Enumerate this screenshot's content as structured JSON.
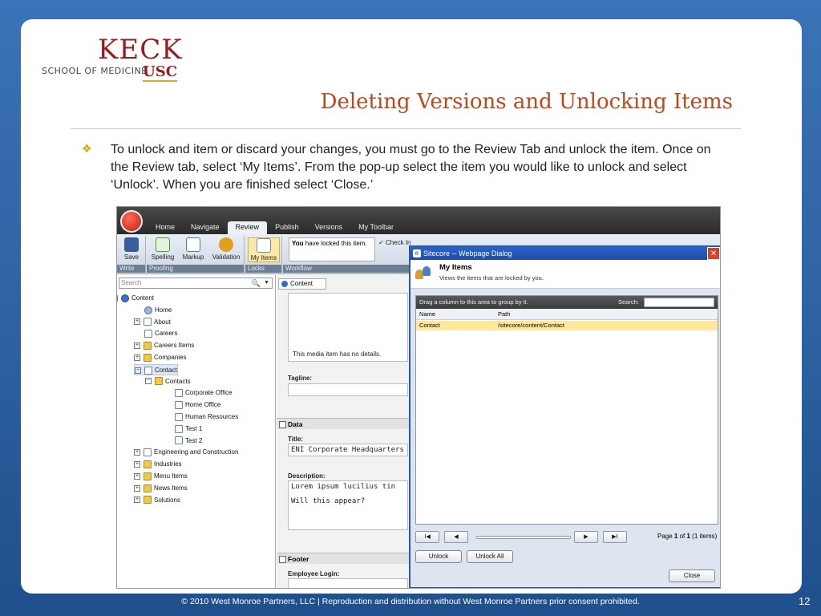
{
  "logo": {
    "line1": "KECK",
    "line2": "SCHOOL OF MEDICINE",
    "line3": "USC"
  },
  "title": "Deleting Versions and Unlocking Items",
  "body_text": "To unlock and item or discard your changes, you must go to the Review Tab and unlock the item.  Once on the Review tab, select ‘My Items’.  From the pop-up select the item you would like to unlock and select ‘Unlock’.  When you are finished select ‘Close.’",
  "footer": "© 2010 West Monroe Partners, LLC  |  Reproduction and distribution without West Monroe Partners prior consent prohibited.",
  "page_number": "12",
  "app": {
    "tabs": [
      "Home",
      "Navigate",
      "Review",
      "Publish",
      "Versions",
      "My Toolbar"
    ],
    "active_tab": "Review",
    "ribbon": {
      "save": "Save",
      "write_label": "Write",
      "spelling": "Spelling",
      "markup": "Markup",
      "validation": "Validation",
      "proofing_label": "Proofing",
      "my_items": "My Items",
      "locks_label": "Locks",
      "notice_bold": "You",
      "notice_rest": " have locked this item.",
      "check_in": "Check In",
      "workflow_label": "Workflow"
    },
    "search_placeholder": "Search",
    "tree": [
      {
        "label": "Content",
        "depth": 0,
        "icon": "content",
        "expander": "−"
      },
      {
        "label": "Home",
        "depth": 1,
        "icon": "home",
        "expander": ""
      },
      {
        "label": "About",
        "depth": 1,
        "icon": "doc",
        "expander": "+"
      },
      {
        "label": "Careers",
        "depth": 1,
        "icon": "doc",
        "expander": ""
      },
      {
        "label": "Careers Items",
        "depth": 1,
        "icon": "folder",
        "expander": "+"
      },
      {
        "label": "Companies",
        "depth": 1,
        "icon": "folder",
        "expander": "+"
      },
      {
        "label": "Contact",
        "depth": 1,
        "icon": "doc",
        "expander": "−",
        "selected": true
      },
      {
        "label": "Contacts",
        "depth": 2,
        "icon": "folder",
        "expander": "−"
      },
      {
        "label": "Corporate Office",
        "depth": 3,
        "icon": "doc",
        "expander": ""
      },
      {
        "label": "Home Office",
        "depth": 3,
        "icon": "doc",
        "expander": ""
      },
      {
        "label": "Human Resources",
        "depth": 3,
        "icon": "doc",
        "expander": ""
      },
      {
        "label": "Test 1",
        "depth": 3,
        "icon": "doc",
        "expander": ""
      },
      {
        "label": "Test 2",
        "depth": 3,
        "icon": "doc",
        "expander": ""
      },
      {
        "label": "Engineering and Construction",
        "depth": 1,
        "icon": "doc",
        "expander": "+"
      },
      {
        "label": "Industries",
        "depth": 1,
        "icon": "folder",
        "expander": "+"
      },
      {
        "label": "Menu Items",
        "depth": 1,
        "icon": "folder",
        "expander": "+"
      },
      {
        "label": "News Items",
        "depth": 1,
        "icon": "folder",
        "expander": "+"
      },
      {
        "label": "Solutions",
        "depth": 1,
        "icon": "folder",
        "expander": "+"
      }
    ],
    "editor": {
      "tab": "Content",
      "media_note": "This media item has no details.",
      "tagline_label": "Tagline:",
      "data_section": "Data",
      "title_label": "Title:",
      "title_value": "ENI Corporate Headquarters",
      "description_label": "Description:",
      "description_line1": "Lorem ipsum lucilius tin",
      "description_line2": "Will this appear?",
      "footer_section": "Footer",
      "employee_login_label": "Employee Login:"
    },
    "dialog": {
      "title": "Sitecore -- Webpage Dialog",
      "heading": "My Items",
      "subheading": "Views the items that are locked by you.",
      "group_hint": "Drag a column to this area to group by it.",
      "search_label": "Search:",
      "columns": [
        "Name",
        "Path"
      ],
      "rows": [
        {
          "name": "Contact",
          "path": "/sitecore/content/Contact"
        }
      ],
      "pager_first": "I◀",
      "pager_prev": "◀",
      "pager_next": "▶",
      "pager_last": "▶I",
      "pager_text_prefix": "Page ",
      "pager_page": "1",
      "pager_of": " of ",
      "pager_total": "1",
      "pager_count": " (1 items)",
      "unlock": "Unlock",
      "unlock_all": "Unlock All",
      "close": "Close"
    }
  },
  "colors": {
    "title": "#c0461c",
    "bullet": "#d6a300",
    "selected_row": "#ffe89a",
    "background_blue": "#2c5f9e"
  }
}
